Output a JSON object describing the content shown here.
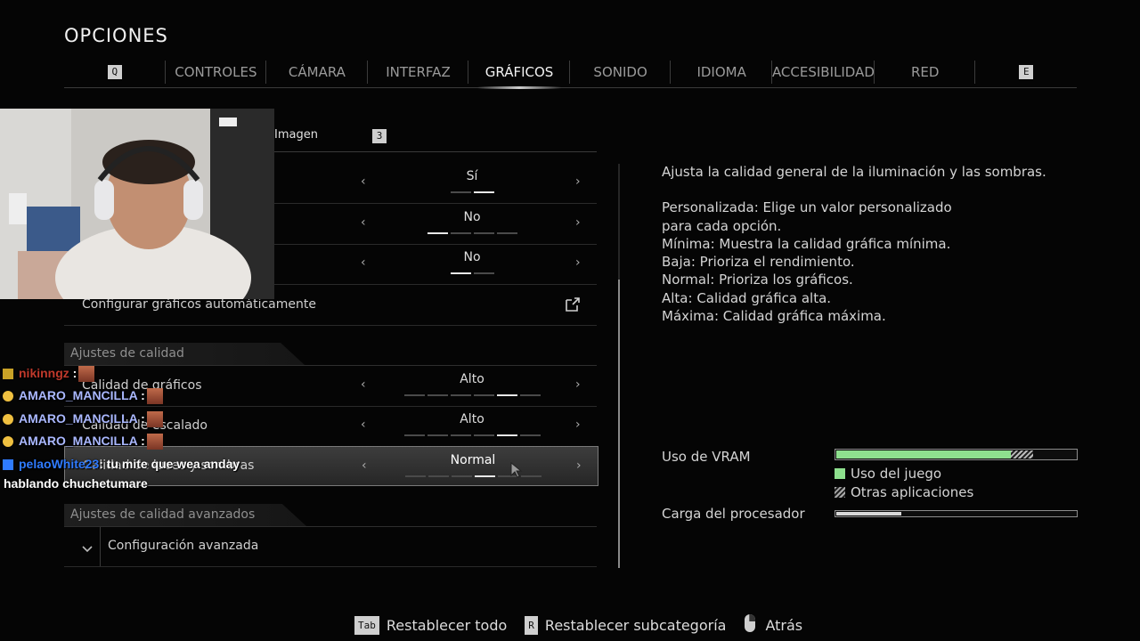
{
  "header": {
    "title": "OPCIONES"
  },
  "tabs": {
    "left_key": "Q",
    "right_key": "E",
    "items": [
      "CONTROLES",
      "CÁMARA",
      "INTERFAZ",
      "GRÁFICOS",
      "SONIDO",
      "IDIOMA",
      "ACCESIBILIDAD",
      "RED"
    ],
    "active": "GRÁFICOS"
  },
  "subtab": {
    "label": "Imagen",
    "key": "3"
  },
  "rows_top": [
    {
      "value": "Sí",
      "level": [
        2,
        2
      ]
    },
    {
      "value": "No",
      "level": [
        1,
        4
      ]
    },
    {
      "value": "No",
      "level": [
        1,
        2
      ]
    }
  ],
  "auto_config": {
    "label": "Configurar gráficos automáticamente"
  },
  "quality_section": {
    "title": "Ajustes de calidad"
  },
  "quality_rows": [
    {
      "label": "Calidad de gráficos",
      "value": "Alto",
      "level": [
        5,
        6
      ]
    },
    {
      "label": "Calidad de escalado",
      "value": "Alto",
      "level": [
        5,
        6
      ]
    },
    {
      "label": "Calidad de luces y sombras",
      "value": "Normal",
      "level": [
        4,
        6
      ]
    }
  ],
  "advanced_section": {
    "title": "Ajustes de calidad avanzados"
  },
  "advanced_config": {
    "label": "Configuración avanzada"
  },
  "description": {
    "intro": "Ajusta la calidad general de la iluminación y las sombras.",
    "lines": [
      "Personalizada: Elige un valor personalizado",
      "para cada opción.",
      "Mínima: Muestra la calidad gráfica mínima.",
      "Baja: Prioriza el rendimiento.",
      "Normal: Prioriza los gráficos.",
      "Alta: Calidad gráfica alta.",
      "Máxima: Calidad gráfica máxima."
    ]
  },
  "vram": {
    "label": "Uso de VRAM",
    "game_fraction": 0.73,
    "other_fraction": 0.09,
    "legend_game": "Uso del juego",
    "legend_other": "Otras aplicaciones",
    "game_color": "#8ee08e"
  },
  "cpu": {
    "label": "Carga del procesador",
    "fraction": 0.27
  },
  "footer": [
    {
      "key": "Tab",
      "label": "Restablecer todo"
    },
    {
      "key": "R",
      "label": "Restablecer subcategoría"
    },
    {
      "key": "mouse-icon",
      "label": "Atrás"
    }
  ],
  "chat": [
    {
      "user": "nikinngz",
      "color": "#c0392b",
      "text": ":"
    },
    {
      "user": "AMARO_MANCILLA",
      "color": "#aab8ff",
      "text": ":"
    },
    {
      "user": "AMARO_MANCILLA",
      "color": "#aab8ff",
      "text": ":"
    },
    {
      "user": "AMARO_MANCILLA",
      "color": "#aab8ff",
      "text": ":"
    },
    {
      "user": "pelaoWhite23",
      "color": "#2f7bff",
      "text": ": tu mite que wea anday"
    },
    {
      "user": "",
      "color": "#ffffff",
      "text": "hablando chuchetumare"
    }
  ]
}
